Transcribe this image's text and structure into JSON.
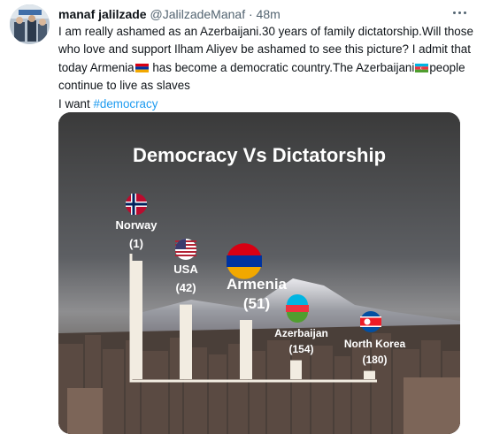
{
  "tweet": {
    "author_name": "manaf jalilzade",
    "handle": "@JalilzadeManaf",
    "separator": "·",
    "time": "48m",
    "text_part1": "I am really ashamed as an Azerbaijani.30 years of family dictatorship.Will those who love and support Ilham Aliyev be ashamed to see this picture? I admit that today Armenia",
    "text_part2": " has become a democratic country.The Azerbaijani",
    "text_part3": "people continue to live as slaves",
    "text_part4": "I want ",
    "hashtag": "#democracy"
  },
  "icons": {
    "avatar": "profile-photo",
    "more": "more-dots-icon",
    "flag_armenia": "armenia-flag-icon",
    "flag_azerbaijan": "azerbaijan-flag-icon"
  },
  "colors": {
    "hashtag": "#1d9bf0",
    "bar": "#f2ece1",
    "chart_text": "#ffffff"
  },
  "chart_data": {
    "type": "bar",
    "title": "Democracy Vs Dictatorship",
    "categories": [
      "Norway",
      "USA",
      "Armenia",
      "Azerbaijan",
      "North Korea"
    ],
    "value_labels": [
      "(1)",
      "(42)",
      "(51)",
      "(154)",
      "(180)"
    ],
    "values": [
      1,
      42,
      51,
      154,
      180
    ],
    "bar_heights_relative": [
      1.0,
      0.63,
      0.5,
      0.16,
      0.07
    ],
    "note_scale": "bars depict democracy ranking; lower rank = taller bar",
    "grid": false,
    "legend": "none"
  }
}
